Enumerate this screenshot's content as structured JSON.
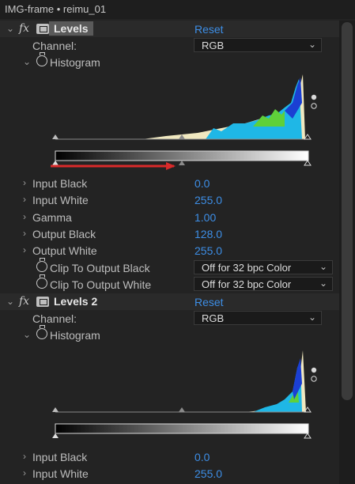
{
  "window": {
    "title": "IMG-frame • reimu_01"
  },
  "effects": [
    {
      "name": "Levels",
      "reset": "Reset",
      "channel_label": "Channel:",
      "channel": "RGB",
      "histogram_label": "Histogram",
      "input_black_label": "Input Black",
      "input_black": "0.0",
      "input_white_label": "Input White",
      "input_white": "255.0",
      "gamma_label": "Gamma",
      "gamma": "1.00",
      "output_black_label": "Output Black",
      "output_black": "128.0",
      "output_white_label": "Output White",
      "output_white": "255.0",
      "clip_black_label": "Clip To Output Black",
      "clip_black": "Off for 32 bpc Color",
      "clip_white_label": "Clip To Output White",
      "clip_white": "Off for 32 bpc Color"
    },
    {
      "name": "Levels 2",
      "reset": "Reset",
      "channel_label": "Channel:",
      "channel": "RGB",
      "histogram_label": "Histogram",
      "input_black_label": "Input Black",
      "input_black": "0.0",
      "input_white_label": "Input White",
      "input_white": "255.0"
    }
  ],
  "colors": {
    "accent": "#3d8ee6",
    "annotation_arrow": "#d92a2a"
  }
}
